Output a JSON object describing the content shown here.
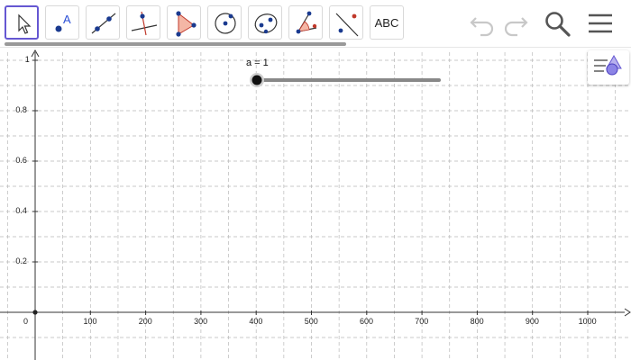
{
  "toolbar": {
    "tools": [
      {
        "name": "move-tool"
      },
      {
        "name": "point-tool"
      },
      {
        "name": "line-tool"
      },
      {
        "name": "perpendicular-line-tool"
      },
      {
        "name": "polygon-tool"
      },
      {
        "name": "circle-tool"
      },
      {
        "name": "conic-tool"
      },
      {
        "name": "angle-tool"
      },
      {
        "name": "reflect-tool"
      },
      {
        "name": "text-tool",
        "label": "ABC"
      }
    ]
  },
  "slider": {
    "label": "a = 1",
    "value": 1
  },
  "axes": {
    "x_ticks": [
      "0",
      "100",
      "200",
      "300",
      "400",
      "500",
      "600",
      "700",
      "800",
      "900",
      "1000"
    ],
    "y_ticks": [
      "1",
      "0.8",
      "0.6",
      "0.4",
      "0.2"
    ]
  },
  "colors": {
    "accent": "#6557d2",
    "point": "#1565c0",
    "polygon_fill": "#f4b6a5",
    "grid": "#b8b8b8"
  }
}
